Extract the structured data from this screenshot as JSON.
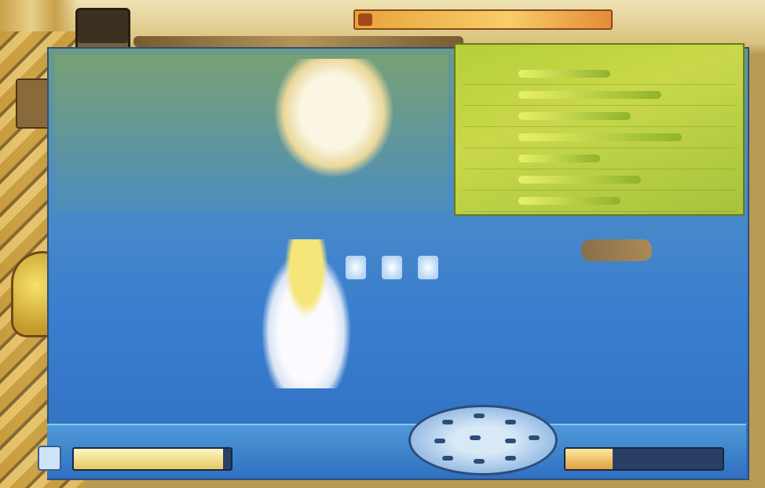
{
  "window": {
    "title": ""
  },
  "top_banner": {
    "label": ""
  },
  "info_panel": {
    "title": "",
    "rows": [
      {
        "label": "",
        "level": 0.45
      },
      {
        "label": "",
        "level": 0.7
      },
      {
        "label": "",
        "level": 0.55
      },
      {
        "label": "",
        "level": 0.8
      },
      {
        "label": "",
        "level": 0.4
      },
      {
        "label": "",
        "level": 0.6
      },
      {
        "label": "",
        "level": 0.5
      }
    ]
  },
  "hud": {
    "left_gauge_level": 0.95,
    "right_gauge_level": 0.3
  },
  "colors": {
    "playfield": "#3a7fcf",
    "panel": "#b6cf3a",
    "frame": "#c9a14a",
    "banner": "#f7cd6a"
  },
  "icons": {
    "top_left": "portrait-icon",
    "banner": "flag-icon",
    "compass": "radar-icon",
    "hud_left": "item-slot-icon"
  }
}
